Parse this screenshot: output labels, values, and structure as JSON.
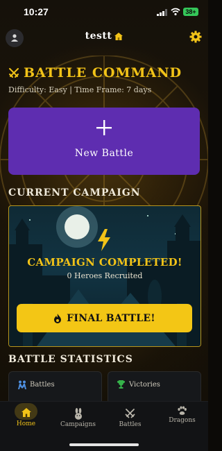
{
  "status_bar": {
    "time": "10:27",
    "battery": "38+"
  },
  "header": {
    "title": "testt"
  },
  "hero": {
    "heading": "BATTLE COMMAND",
    "subtitle": "Difficulty: Easy | Time Frame: 7 days"
  },
  "new_battle": {
    "label": "New Battle"
  },
  "campaign": {
    "section_title": "CURRENT CAMPAIGN",
    "status": "CAMPAIGN COMPLETED!",
    "heroes": "0 Heroes Recruited",
    "final_button": "FINAL BATTLE!"
  },
  "stats": {
    "section_title": "BATTLE STATISTICS",
    "battles_label": "Battles",
    "victories_label": "Victories"
  },
  "tabs": [
    {
      "label": "Home",
      "icon": "home-icon",
      "active": true
    },
    {
      "label": "Campaigns",
      "icon": "rabbit-icon",
      "active": false
    },
    {
      "label": "Battles",
      "icon": "crossed-swords-icon",
      "active": false
    },
    {
      "label": "Dragons",
      "icon": "paw-icon",
      "active": false
    }
  ],
  "colors": {
    "accent": "#f2c318",
    "primary_button": "#5e2db0",
    "final_button": "#f3c615",
    "background": "#0c0a07"
  }
}
